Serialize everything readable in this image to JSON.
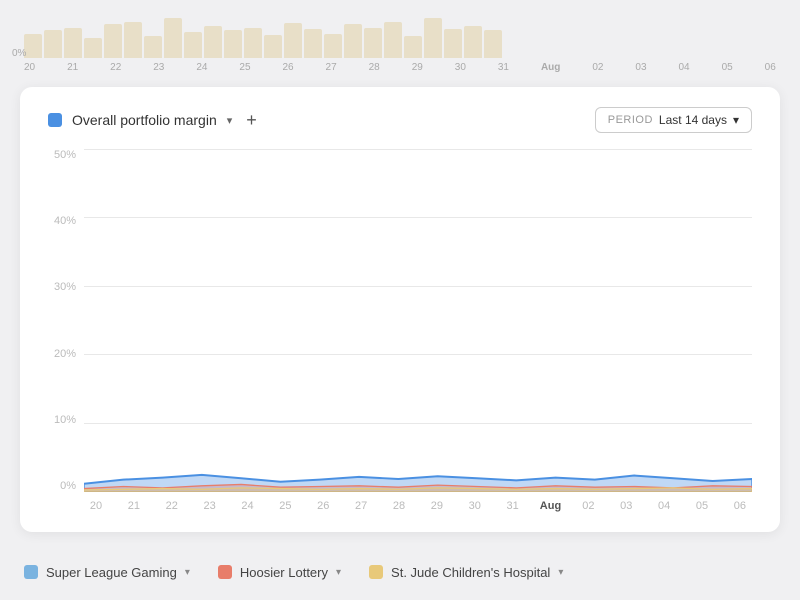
{
  "topChart": {
    "zeroLabel": "0%",
    "bars": [
      30,
      35,
      38,
      25,
      42,
      45,
      28,
      50,
      32,
      40,
      35,
      38,
      29,
      44,
      36,
      30,
      42,
      38,
      45,
      28,
      50,
      36,
      40,
      35
    ],
    "axisLabels": [
      "20",
      "21",
      "22",
      "23",
      "24",
      "25",
      "26",
      "27",
      "28",
      "29",
      "30",
      "31",
      "Aug",
      "02",
      "03",
      "04",
      "05",
      "06"
    ]
  },
  "card": {
    "legendDotColor": "#4a90e2",
    "title": "Overall portfolio margin",
    "addButtonLabel": "+",
    "period": {
      "label": "PERIOD",
      "value": "Last 14 days",
      "chevron": "▾"
    },
    "yAxisLabels": [
      "50%",
      "40%",
      "30%",
      "20%",
      "10%",
      "0%"
    ],
    "xAxisLabels": [
      "20",
      "21",
      "22",
      "23",
      "24",
      "25",
      "26",
      "27",
      "28",
      "29",
      "30",
      "31",
      "Aug",
      "02",
      "03",
      "04",
      "05",
      "06"
    ],
    "augIndex": 12
  },
  "legend": {
    "items": [
      {
        "label": "Super League Gaming",
        "color": "#7ab3e0"
      },
      {
        "label": "Hoosier Lottery",
        "color": "#e87d6a"
      },
      {
        "label": "St. Jude Children's Hospital",
        "color": "#e8c97a"
      }
    ]
  }
}
